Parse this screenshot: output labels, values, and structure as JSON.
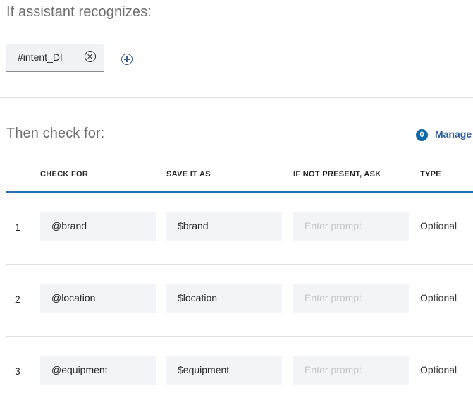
{
  "condition": {
    "title": "If assistant recognizes:",
    "chip_label": "#intent_DI"
  },
  "slots": {
    "title": "Then check for:",
    "manage_count": "0",
    "manage_label": "Manage",
    "headers": {
      "check_for": "CHECK FOR",
      "save_it_as": "SAVE IT AS",
      "if_not_present": "IF NOT PRESENT, ASK",
      "type": "TYPE"
    },
    "rows": [
      {
        "num": "1",
        "check_for": "@brand",
        "save_as": "$brand",
        "prompt_placeholder": "Enter prompt",
        "type": "Optional"
      },
      {
        "num": "2",
        "check_for": "@location",
        "save_as": "$location",
        "prompt_placeholder": "Enter prompt",
        "type": "Optional"
      },
      {
        "num": "3",
        "check_for": "@equipment",
        "save_as": "$equipment",
        "prompt_placeholder": "Enter prompt",
        "type": "Optional"
      }
    ]
  },
  "colors": {
    "accent": "#2c6fb5",
    "badge": "#0b6aa8",
    "field_bg": "#f2f4f8"
  }
}
